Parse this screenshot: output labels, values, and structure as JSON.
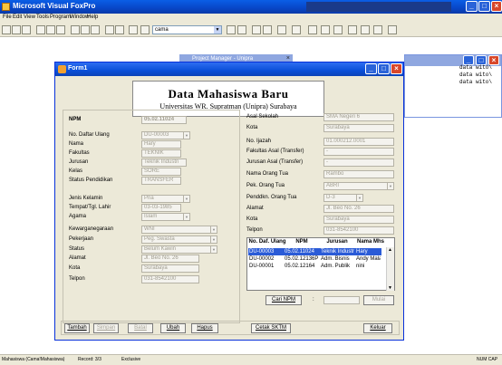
{
  "app": {
    "title": "Microsoft Visual FoxPro"
  },
  "menu": [
    "File",
    "Edit",
    "View",
    "Tools",
    "Program",
    "Window",
    "Help"
  ],
  "toolbar": {
    "combo_value": "cama"
  },
  "bg_windows": {
    "project_manager": "Project Manager - Unipra",
    "command_lines": [
      "data wito\\",
      "data wito\\",
      "data wito\\"
    ]
  },
  "form": {
    "title": "Form1",
    "header_title": "Data Mahasiswa Baru",
    "header_subtitle": "Universitas WR. Supratman (Unipra) Surabaya",
    "left_fields": [
      {
        "label": "NPM",
        "value": "05.02.11024"
      },
      {
        "label": "No. Daftar Ulang",
        "value": "DU-00003"
      },
      {
        "label": "Nama",
        "value": "Hary"
      },
      {
        "label": "Fakultas",
        "value": "TEKNIK"
      },
      {
        "label": "Jurusan",
        "value": "Teknik Industri"
      },
      {
        "label": "Kelas",
        "value": "SORE"
      },
      {
        "label": "Status Pendidikan",
        "value": "TRANSFER"
      },
      {
        "label": "Jenis Kelamin",
        "value": "Pria"
      },
      {
        "label": "Tempat/Tgl. Lahir",
        "value": "03-03-1985"
      },
      {
        "label": "Agama",
        "value": "Islam"
      },
      {
        "label": "Kewarganegaraan",
        "value": "WNI"
      },
      {
        "label": "Pekerjaan",
        "value": "Peg. Swasta"
      },
      {
        "label": "Status",
        "value": "Belum Kawin"
      },
      {
        "label": "Alamat",
        "value": "Jl. Beo No. 26"
      },
      {
        "label": "Kota",
        "value": "Surabaya"
      },
      {
        "label": "Telpon",
        "value": "031-8542100"
      }
    ],
    "right_fields": [
      {
        "label": "Asal Sekolah",
        "value": "SMA Negeri 6"
      },
      {
        "label": "Kota",
        "value": "Surabaya"
      },
      {
        "label": "No. Ijazah",
        "value": "01.000212.0001"
      },
      {
        "label": "Fakultas Asal (Transfer)",
        "value": "-"
      },
      {
        "label": "Jurusan Asal (Transfer)",
        "value": "-"
      },
      {
        "label": "Nama Orang Tua",
        "value": "Rambo"
      },
      {
        "label": "Pek. Orang Tua",
        "value": "ABRI"
      },
      {
        "label": "Penddkn. Orang Tua",
        "value": "D-3"
      },
      {
        "label": "Alamat",
        "value": "Jl. Beo No. 26"
      },
      {
        "label": "Kota",
        "value": "Surabaya"
      },
      {
        "label": "Telpon",
        "value": "031-8542100"
      }
    ],
    "grid": {
      "columns": [
        "No. Daf. Ulang",
        "NPM",
        "Jurusan",
        "Nama Mhs"
      ],
      "rows": [
        {
          "du": "DU-00003",
          "npm": "05.02.11024",
          "jurusan": "Teknik Industri",
          "nama": "Hary"
        },
        {
          "du": "DU-00002",
          "npm": "05.02.12136P",
          "jurusan": "Adm. Bisnis",
          "nama": "Andy Malarange"
        },
        {
          "du": "DU-00001",
          "npm": "05.02.12164",
          "jurusan": "Adm. Publik",
          "nama": "nini"
        }
      ]
    },
    "search": {
      "label": "Cari NPM",
      "colon": ":",
      "button": "Mulai"
    },
    "buttons": {
      "tambah": "Tambah",
      "simpan": "Simpan",
      "batal": "Batal",
      "ubah": "Ubah",
      "hapus": "Hapus",
      "cetak": "Cetak SKTM",
      "keluar": "Keluar"
    }
  },
  "statusbar": {
    "table": "Mahasiswa (Cama!Mahasiswa)",
    "record": "Record: 3/3",
    "mode": "Exclusive",
    "keys": "NUM  CAP"
  }
}
